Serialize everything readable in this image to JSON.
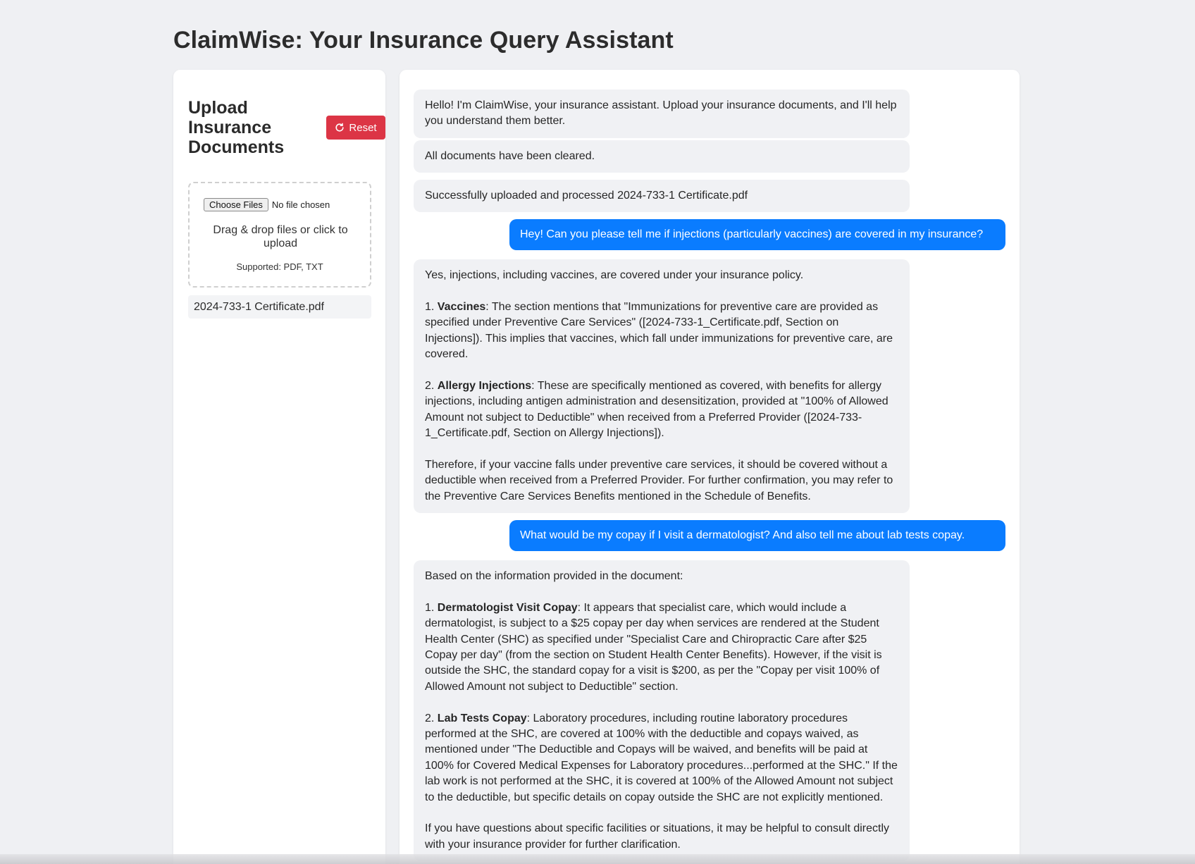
{
  "app": {
    "title": "ClaimWise: Your Insurance Query Assistant"
  },
  "sidebar": {
    "title": "Upload Insurance Documents",
    "reset_label": "Reset",
    "choose_files_label": "Choose Files",
    "no_file_text": "No file chosen",
    "drop_hint": "Drag & drop files or click to upload",
    "supported": "Supported: PDF, TXT",
    "files": [
      "2024-733-1 Certificate.pdf"
    ]
  },
  "colors": {
    "accent": "#0a7cff",
    "danger": "#dc3545",
    "bot_bubble": "#f0f1f4",
    "background": "#eff0f3"
  },
  "messages": [
    {
      "role": "bot",
      "text": "Hello! I'm ClaimWise, your insurance assistant. Upload your insurance documents, and I'll help you understand them better."
    },
    {
      "role": "bot",
      "text": "All documents have been cleared."
    },
    {
      "role": "bot",
      "text": "Successfully uploaded and processed 2024-733-1 Certificate.pdf"
    },
    {
      "role": "user",
      "text": "Hey! Can you please tell me if injections (particularly vaccines) are covered in my insurance?"
    },
    {
      "role": "bot",
      "intro": "Yes, injections, including vaccines, are covered under your insurance policy.",
      "items": [
        {
          "num": "1. ",
          "title": "Vaccines",
          "body": ": The section mentions that \"Immunizations for preventive care are provided as specified under Preventive Care Services\" ([2024-733-1_Certificate.pdf, Section on Injections]). This implies that vaccines, which fall under immunizations for preventive care, are covered."
        },
        {
          "num": "2. ",
          "title": "Allergy Injections",
          "body": ": These are specifically mentioned as covered, with benefits for allergy injections, including antigen administration and desensitization, provided at \"100% of Allowed Amount not subject to Deductible\" when received from a Preferred Provider ([2024-733-1_Certificate.pdf, Section on Allergy Injections])."
        }
      ],
      "outro": "Therefore, if your vaccine falls under preventive care services, it should be covered without a deductible when received from a Preferred Provider. For further confirmation, you may refer to the Preventive Care Services Benefits mentioned in the Schedule of Benefits."
    },
    {
      "role": "user",
      "text": "What would be my copay if I visit a dermatologist? And also tell me about lab tests copay."
    },
    {
      "role": "bot",
      "intro": "Based on the information provided in the document:",
      "items": [
        {
          "num": "1. ",
          "title": "Dermatologist Visit Copay",
          "body": ": It appears that specialist care, which would include a dermatologist, is subject to a $25 copay per day when services are rendered at the Student Health Center (SHC) as specified under \"Specialist Care and Chiropractic Care after $25 Copay per day\" (from the section on Student Health Center Benefits). However, if the visit is outside the SHC, the standard copay for a visit is $200, as per the \"Copay per visit 100% of Allowed Amount not subject to Deductible\" section."
        },
        {
          "num": "2. ",
          "title": "Lab Tests Copay",
          "body": ": Laboratory procedures, including routine laboratory procedures performed at the SHC, are covered at 100% with the deductible and copays waived, as mentioned under \"The Deductible and Copays will be waived, and benefits will be paid at 100% for Covered Medical Expenses for Laboratory procedures...performed at the SHC.\" If the lab work is not performed at the SHC, it is covered at 100% of the Allowed Amount not subject to the deductible, but specific details on copay outside the SHC are not explicitly mentioned."
        }
      ],
      "outro": "If you have questions about specific facilities or situations, it may be helpful to consult directly with your insurance provider for further clarification."
    }
  ]
}
